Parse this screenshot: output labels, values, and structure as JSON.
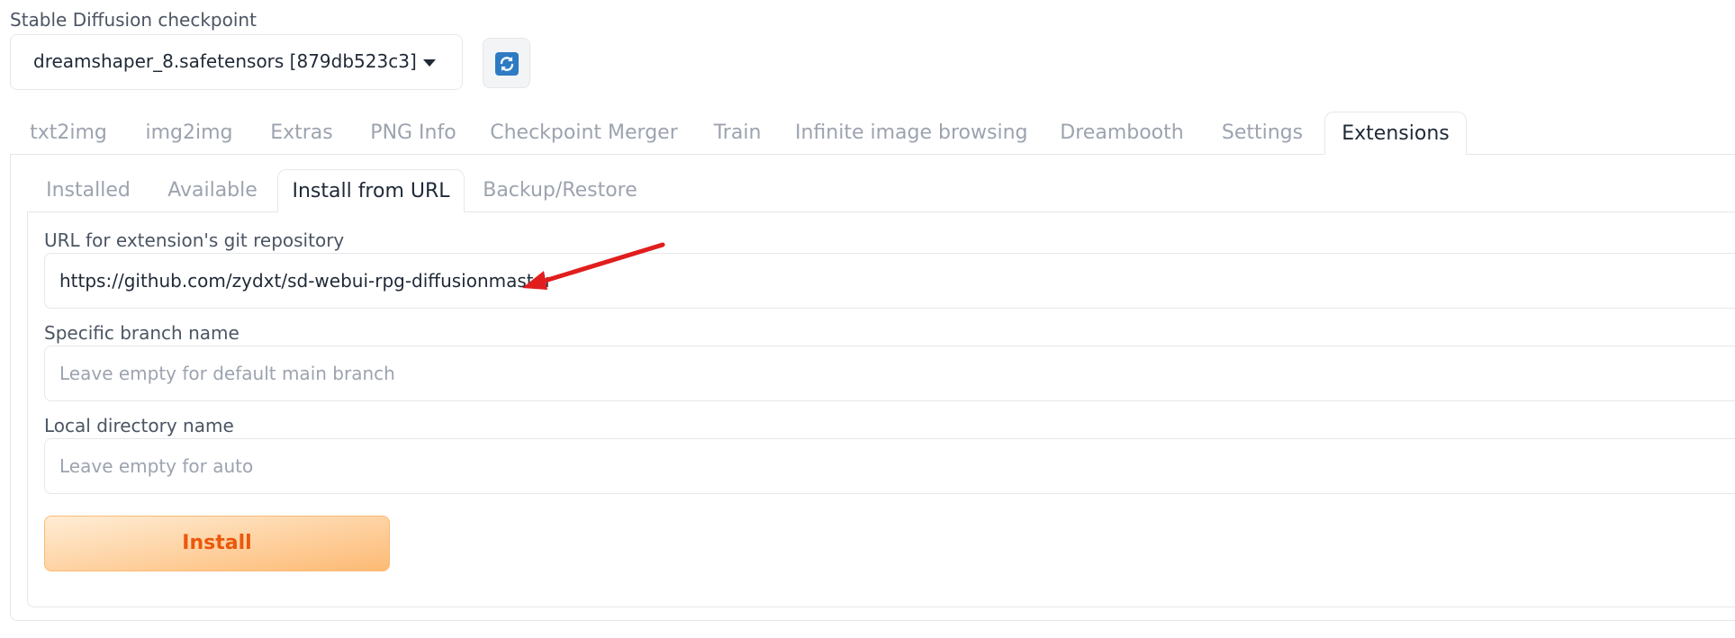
{
  "checkpoint": {
    "label": "Stable Diffusion checkpoint",
    "selected": "dreamshaper_8.safetensors [879db523c3]",
    "refresh_icon": "refresh-icon"
  },
  "top_tabs": [
    {
      "label": "txt2img",
      "active": false
    },
    {
      "label": "img2img",
      "active": false
    },
    {
      "label": "Extras",
      "active": false
    },
    {
      "label": "PNG Info",
      "active": false
    },
    {
      "label": "Checkpoint Merger",
      "active": false
    },
    {
      "label": "Train",
      "active": false
    },
    {
      "label": "Infinite image browsing",
      "active": false
    },
    {
      "label": "Dreambooth",
      "active": false
    },
    {
      "label": "Settings",
      "active": false
    },
    {
      "label": "Extensions",
      "active": true
    }
  ],
  "sub_tabs": [
    {
      "label": "Installed",
      "active": false
    },
    {
      "label": "Available",
      "active": false
    },
    {
      "label": "Install from URL",
      "active": true
    },
    {
      "label": "Backup/Restore",
      "active": false
    }
  ],
  "form": {
    "url_label": "URL for extension's git repository",
    "url_value": "https://github.com/zydxt/sd-webui-rpg-diffusionmaster",
    "branch_label": "Specific branch name",
    "branch_placeholder": "Leave empty for default main branch",
    "dir_label": "Local directory name",
    "dir_placeholder": "Leave empty for auto",
    "install_label": "Install"
  },
  "annotation": {
    "arrow_color": "#e11d1d"
  },
  "colors": {
    "install_text": "#ea580c",
    "install_gradient_from": "#ffedd5",
    "install_gradient_to": "#fdba74",
    "refresh_icon": "#2e7bc4"
  }
}
